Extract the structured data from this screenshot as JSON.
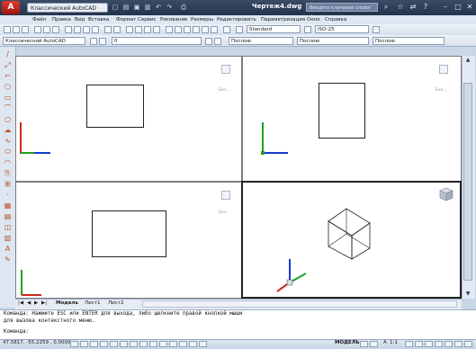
{
  "titlebar": {
    "workspace": "Классический AutoCAD",
    "doc_title": "Чертеж4.dwg",
    "search_placeholder": "Введите ключевое слово/фразу"
  },
  "menu": [
    "Файл",
    "Правка",
    "Вид",
    "Вставка",
    "Формат",
    "Сервис",
    "Рисование",
    "Размеры",
    "Редактировать",
    "Параметризация",
    "Окно",
    "Справка"
  ],
  "toolbar": {
    "text_style": "Standard",
    "dim_style": "ISO-25",
    "workspace_combo": "Классический AutoCAD",
    "layer": "0",
    "color": "Послою",
    "linetype": "Послою",
    "lineweight": "Послою"
  },
  "viewports": {
    "top_left_label": "Без...",
    "top_right_label": "Без...",
    "bottom_left_label": "Без...",
    "bottom_right_label": ""
  },
  "tabs": {
    "model": "Модель",
    "sheet1": "Лист1",
    "sheet2": "Лист2"
  },
  "command": {
    "line1": "Команда:  Нажмите ESC или ENTER для выхода, либо щелкните правой кнопкой мыши",
    "line2": "для вызова контекстного меню.",
    "line3": "Команда:"
  },
  "status": {
    "coords": "47.5817, -55.2259 , 0.0000",
    "model_label": "МОДЕЛЬ",
    "annot_scale": "1:1"
  },
  "colors": {
    "axis_x": "#cc2a1a",
    "axis_y": "#20a020",
    "axis_z": "#1a3acc",
    "title_bg": "#2b3d57"
  }
}
